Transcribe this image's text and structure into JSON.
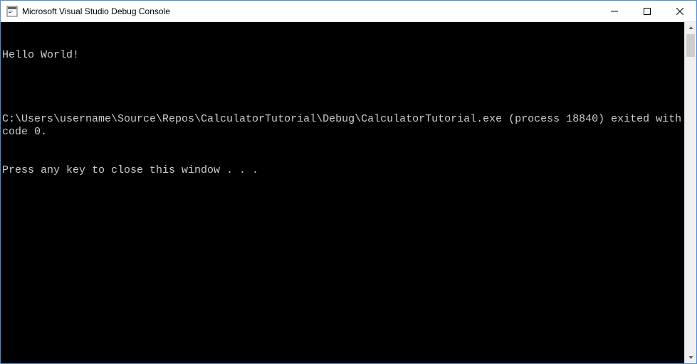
{
  "window": {
    "title": "Microsoft Visual Studio Debug Console"
  },
  "console": {
    "line1": "Hello World!",
    "line2": "",
    "line3": "C:\\Users\\username\\Source\\Repos\\CalculatorTutorial\\Debug\\CalculatorTutorial.exe (process 18840) exited with code 0.",
    "line4": "Press any key to close this window . . ."
  }
}
